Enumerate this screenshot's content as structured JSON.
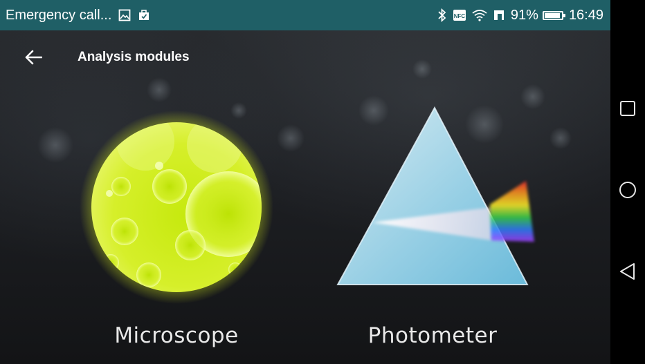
{
  "status_bar": {
    "carrier_text": "Emergency call...",
    "left_icons": [
      "image-icon",
      "briefcase-icon"
    ],
    "right_icons": [
      "bluetooth-icon",
      "nfc-icon",
      "wifi-icon",
      "vibrate-icon"
    ],
    "battery_percent": "91%",
    "battery_level": 0.91,
    "time": "16:49",
    "background_color": "#1f5f66"
  },
  "app_bar": {
    "title": "Analysis modules",
    "back_icon": "arrow-left-icon"
  },
  "modules": [
    {
      "label": "Microscope",
      "icon": "microscope-sphere-icon",
      "accent": "#d4ef1a"
    },
    {
      "label": "Photometer",
      "icon": "prism-icon",
      "accent": "#a9dff2"
    }
  ],
  "nav_bar": {
    "buttons": [
      "recent-apps-icon",
      "home-icon",
      "back-triangle-icon"
    ]
  }
}
